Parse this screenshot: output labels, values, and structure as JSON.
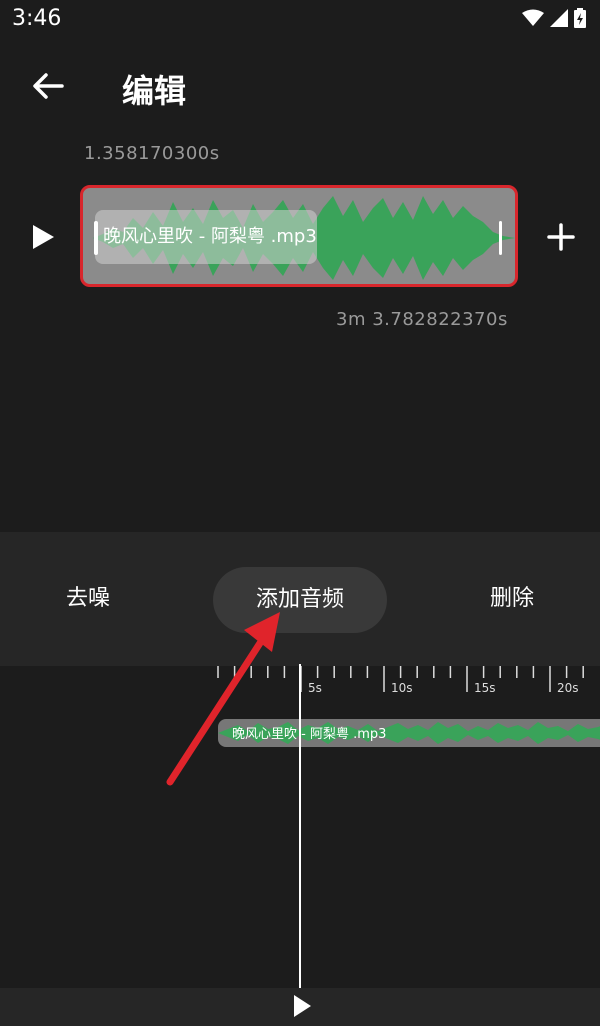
{
  "status_bar": {
    "time": "3:46"
  },
  "header": {
    "title": "编辑"
  },
  "clip": {
    "start_time": "1.358170300s",
    "end_time": "3m 3.782822370s",
    "file_name": "晚风心里吹 - 阿梨粤 .mp3"
  },
  "toolbar": {
    "denoise_label": "去噪",
    "add_audio_label": "添加音频",
    "delete_label": "删除"
  },
  "timeline": {
    "ticks": [
      "5s",
      "10s",
      "15s",
      "20s"
    ],
    "track_label": "晚风心里吹 - 阿梨粤 .mp3"
  },
  "colors": {
    "background": "#1c1c1c",
    "toolbar": "#262626",
    "waveform": "#3aa35a",
    "selection_border": "#d8262c",
    "annotation_arrow": "#e0242b"
  },
  "icons": [
    "back-arrow-icon",
    "play-icon",
    "plus-icon",
    "wifi-icon",
    "signal-icon",
    "battery-icon"
  ]
}
